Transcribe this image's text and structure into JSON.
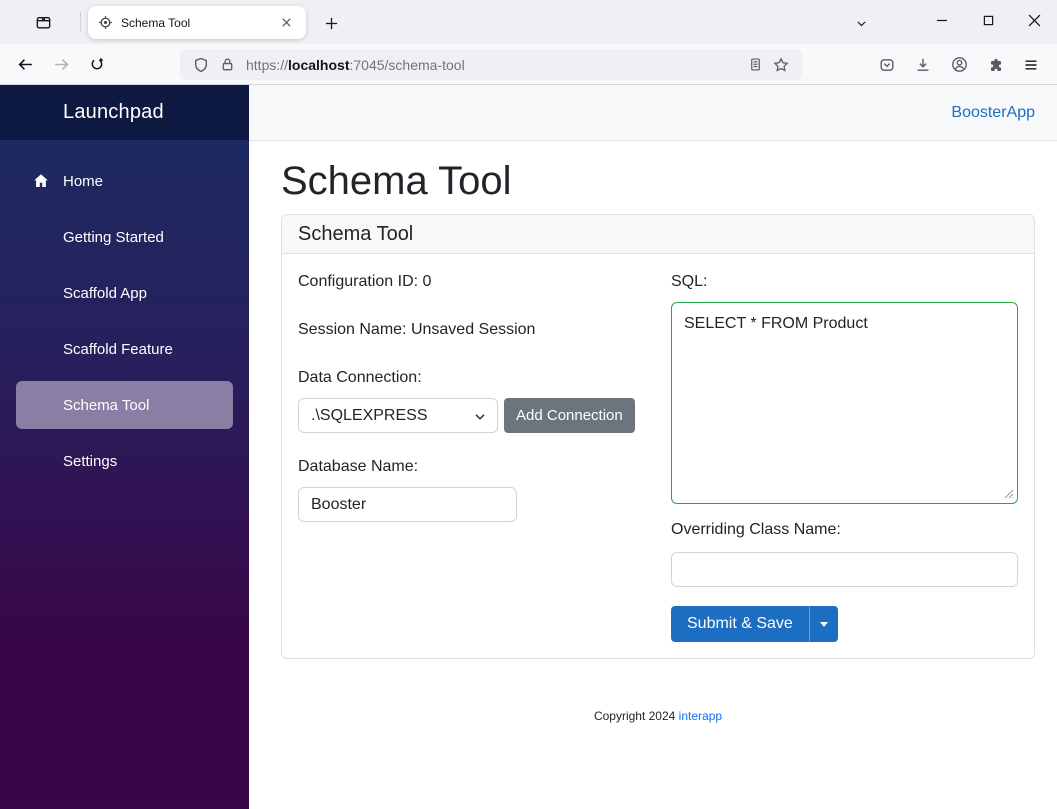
{
  "browser": {
    "tab_title": "Schema Tool",
    "url_scheme": "https://",
    "url_host": "localhost",
    "url_rest": ":7045/schema-tool"
  },
  "app": {
    "sidebar": {
      "title": "Launchpad",
      "items": [
        {
          "label": "Home",
          "active": false
        },
        {
          "label": "Getting Started",
          "active": false
        },
        {
          "label": "Scaffold App",
          "active": false
        },
        {
          "label": "Scaffold Feature",
          "active": false
        },
        {
          "label": "Schema Tool",
          "active": true
        },
        {
          "label": "Settings",
          "active": false
        }
      ]
    },
    "topnav": {
      "brand": "BoosterApp"
    },
    "page": {
      "title": "Schema Tool",
      "card": {
        "header": "Schema Tool",
        "configuration_id": "Configuration ID: 0",
        "session_name": "Session Name: Unsaved Session",
        "data_connection_label": "Data Connection:",
        "data_connection_selected": ".\\SQLEXPRESS",
        "add_connection_button": "Add Connection",
        "database_name_label": "Database Name:",
        "database_name_value": "Booster",
        "sql_label": "SQL:",
        "sql_value": "SELECT * FROM Product",
        "overriding_class_label": "Overriding Class Name:",
        "overriding_class_value": "",
        "submit_button": "Submit & Save"
      },
      "footer": {
        "copyright": "Copyright 2024",
        "link": "interapp"
      }
    },
    "colors": {
      "primary_blue": "#1b6ec2",
      "secondary_gray": "#6c757d",
      "sql_border_green": "#28a745",
      "sidebar_top": "#1b2b61",
      "sidebar_bottom": "#380646",
      "sidebar_active": "#8b7ea4",
      "sidebar_header": "#0d1940"
    }
  }
}
